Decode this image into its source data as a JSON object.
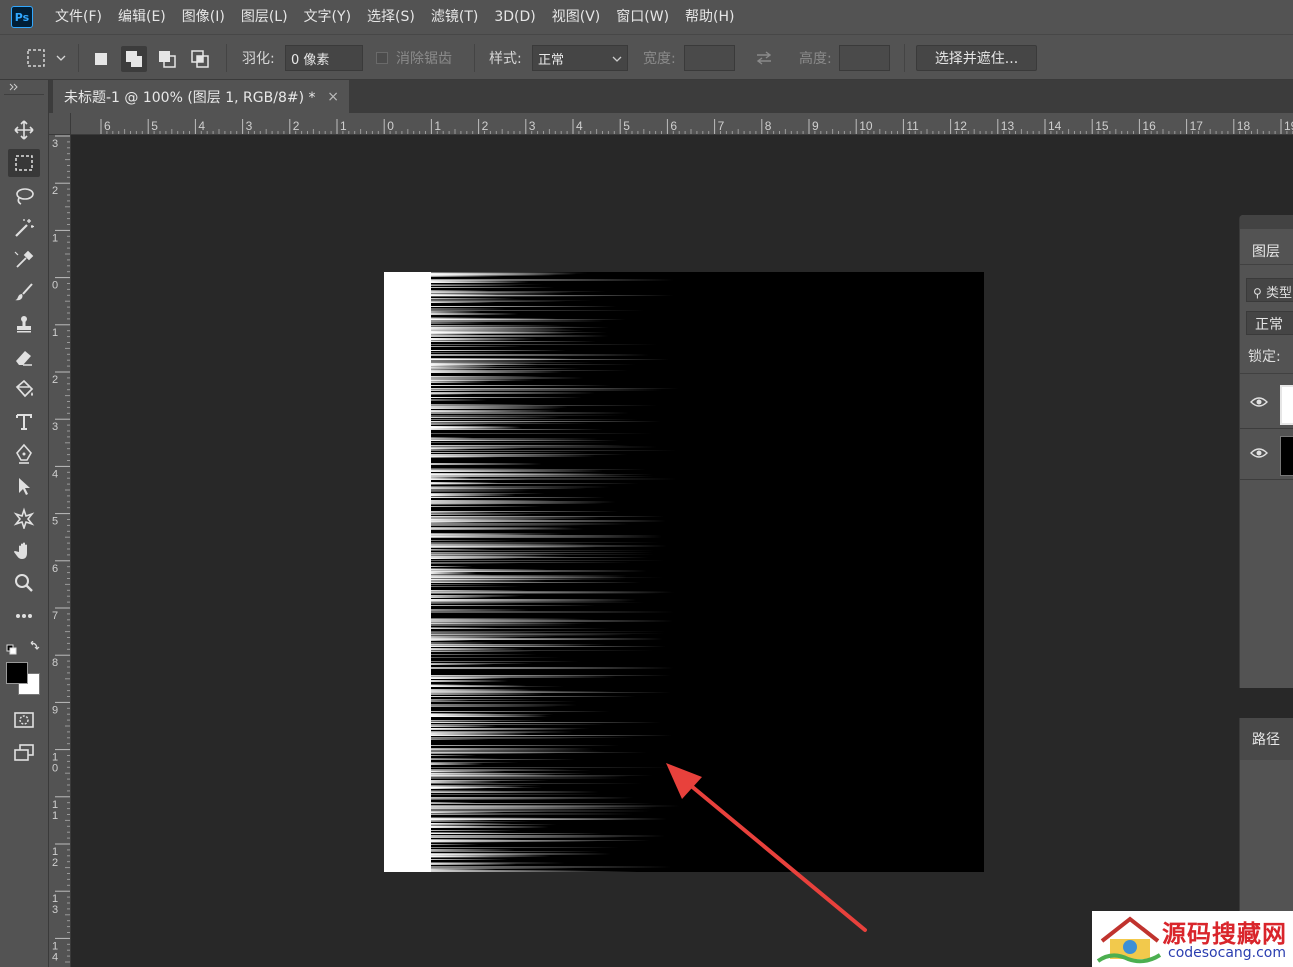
{
  "app": {
    "logo_text": "Ps",
    "menu": [
      "文件(F)",
      "编辑(E)",
      "图像(I)",
      "图层(L)",
      "文字(Y)",
      "选择(S)",
      "滤镜(T)",
      "3D(D)",
      "视图(V)",
      "窗口(W)",
      "帮助(H)"
    ]
  },
  "options_bar": {
    "feather_label": "羽化:",
    "feather_value": "0 像素",
    "antialias_label": "消除锯齿",
    "style_label": "样式:",
    "style_value": "正常",
    "width_label": "宽度:",
    "height_label": "高度:",
    "select_mask_button": "选择并遮住..."
  },
  "document": {
    "tab_title": "未标题-1 @ 100% (图层 1, RGB/8#) *",
    "close_glyph": "×"
  },
  "rulers": {
    "horizontal": [
      "6",
      "5",
      "4",
      "3",
      "2",
      "1",
      "0",
      "1",
      "2",
      "3",
      "4",
      "5",
      "6",
      "7",
      "8",
      "9",
      "10",
      "11",
      "12",
      "13",
      "14",
      "15",
      "16",
      "17",
      "18",
      "19"
    ],
    "vertical": [
      "3",
      "2",
      "1",
      "0",
      "1",
      "2",
      "3",
      "4",
      "5",
      "6",
      "7",
      "8",
      "9",
      "10",
      "11",
      "12",
      "13",
      "14"
    ]
  },
  "tools": [
    "move-tool",
    "marquee-tool",
    "lasso-tool",
    "magic-wand-tool",
    "eyedropper-tool",
    "brush-tool",
    "stamp-tool",
    "eraser-tool",
    "paint-bucket-tool",
    "type-tool",
    "pen-tool",
    "path-selection-tool",
    "custom-shape-tool",
    "hand-tool",
    "zoom-tool",
    "more-tools"
  ],
  "colors": {
    "foreground": "#000000",
    "background": "#ffffff",
    "annotation_arrow": "#e8413c"
  },
  "layers_panel": {
    "tab": "图层",
    "filter_label": "类型",
    "blend_mode": "正常",
    "lock_label": "锁定:"
  },
  "paths_panel": {
    "tab": "路径"
  },
  "watermark": {
    "name": "源码搜藏网",
    "url": "codesocang.com"
  }
}
